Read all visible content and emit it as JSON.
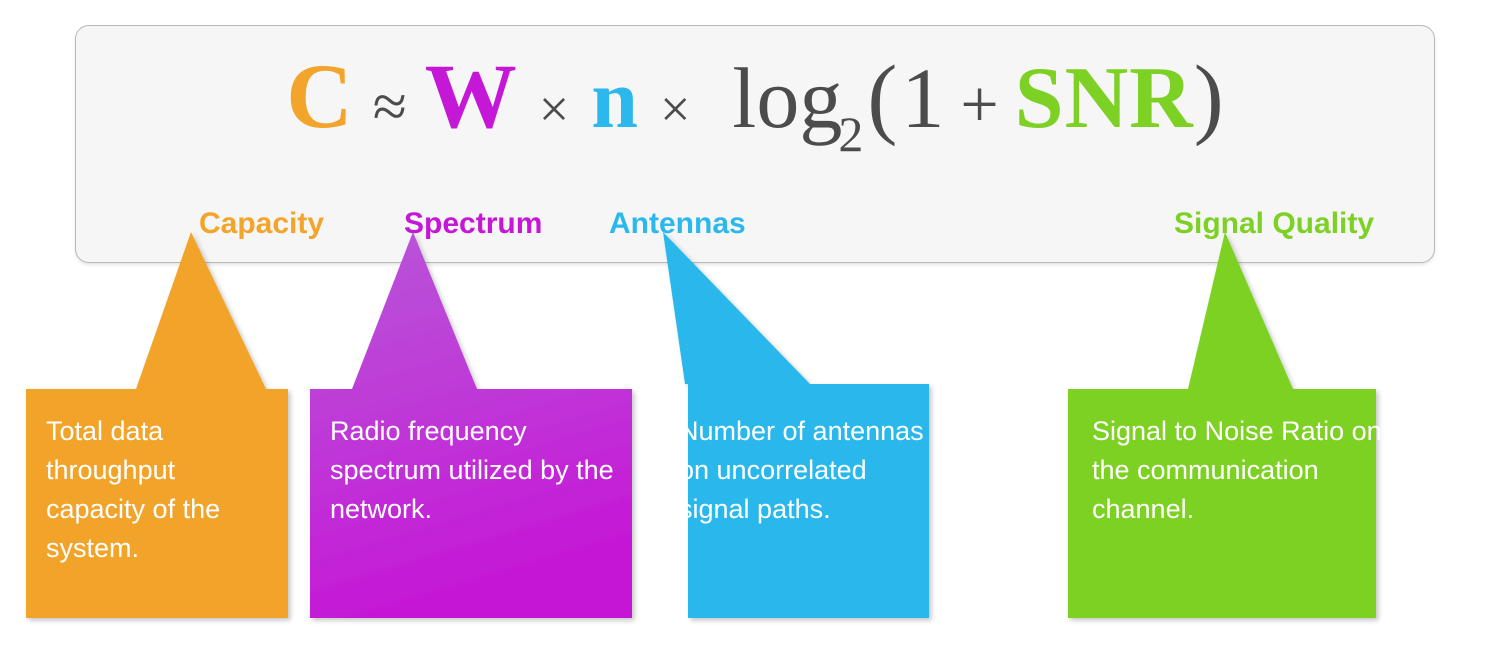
{
  "formula": {
    "capacity_symbol": "C",
    "approx_sign": "≈",
    "spectrum_symbol": "W",
    "times_1": "×",
    "antennas_symbol": "n",
    "times_2": "×",
    "log_text": "log",
    "log_base": "2",
    "paren_open": "(",
    "one": "1",
    "plus": "+",
    "snr_symbol": "SNR",
    "paren_close": ")"
  },
  "legend": {
    "capacity": "Capacity",
    "spectrum": "Spectrum",
    "antennas": "Antennas",
    "signal_quality": "Signal Quality"
  },
  "callouts": [
    {
      "key": "capacity",
      "label": "Capacity",
      "description": "Total data throughput capacity of the system.",
      "color": "#f2a42b",
      "color_top": "#f2a42b",
      "color_bottom": "#f2a42b",
      "pointer": "centered-up"
    },
    {
      "key": "spectrum",
      "label": "Spectrum",
      "description": "Radio frequency spectrum utilized by the network.",
      "color": "#c517d6",
      "color_top": "#b857d8",
      "color_bottom": "#c517d6",
      "pointer": "centered-up"
    },
    {
      "key": "antennas",
      "label": "Antennas",
      "description": "Number of antennas on uncorrelated signal paths.",
      "color": "#2cb8ec",
      "color_top": "#2cb8ec",
      "color_bottom": "#2cb8ec",
      "pointer": "skewed-left-up"
    },
    {
      "key": "signal_quality",
      "label": "Signal Quality",
      "description": "Signal to Noise Ratio on the communication channel.",
      "color": "#7cd124",
      "color_top": "#7cd124",
      "color_bottom": "#7cd124",
      "pointer": "centered-up"
    }
  ],
  "colors": {
    "orange": "#f2a42b",
    "magenta": "#c517d6",
    "magenta_light": "#b857d8",
    "blue": "#2cb8ec",
    "green": "#7cd124",
    "formula_ink": "#4c4c4c",
    "panel_bg": "#f6f6f6",
    "panel_border": "#b9b9b9",
    "page_bg": "#ffffff",
    "callout_text": "#ffffff"
  }
}
